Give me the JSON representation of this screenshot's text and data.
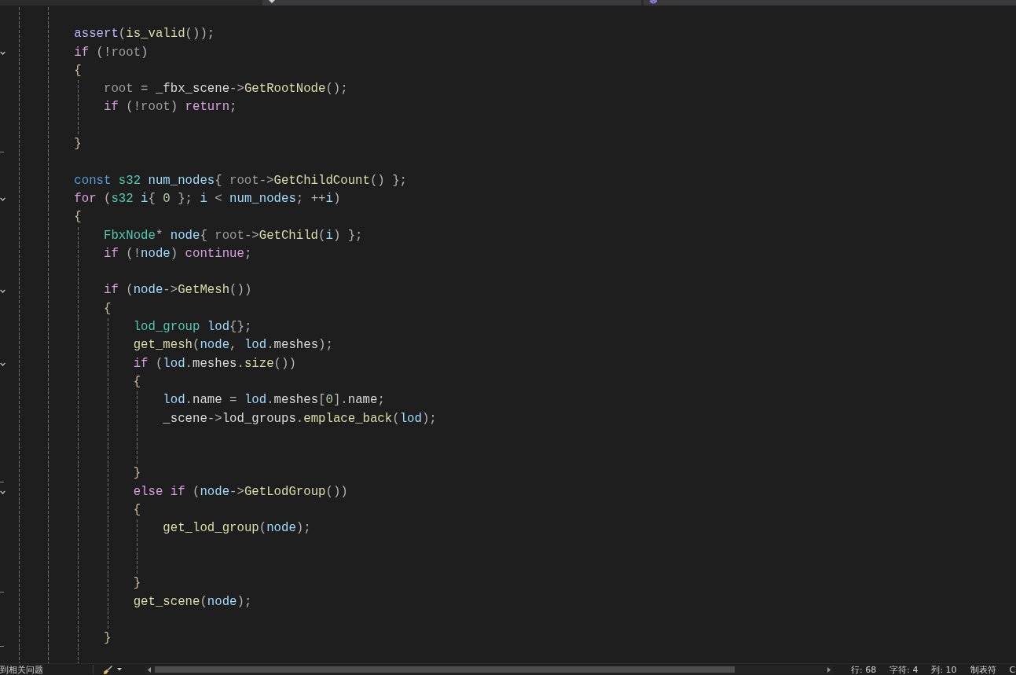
{
  "editor": {
    "items": [
      {
        "kind": "block",
        "children": [
          {
            "kind": "block",
            "children": [
              {
                "kind": "blank"
              },
              {
                "kind": "line",
                "tokens": [
                  {
                    "kind": "macro",
                    "text": "assert"
                  },
                  {
                    "kind": "punct",
                    "text": "("
                  },
                  {
                    "kind": "function",
                    "text": "is_valid"
                  },
                  {
                    "kind": "punct",
                    "text": "());"
                  }
                ]
              },
              {
                "kind": "block",
                "expanded": true,
                "header": [
                  {
                    "kind": "control",
                    "text": "if"
                  },
                  {
                    "kind": "punct",
                    "text": " (!"
                  },
                  {
                    "kind": "muted",
                    "text": "root"
                  },
                  {
                    "kind": "punct",
                    "text": ")"
                  }
                ],
                "open": "{",
                "close": "}",
                "children": [
                  {
                    "kind": "line",
                    "tokens": [
                      {
                        "kind": "muted",
                        "text": "root"
                      },
                      {
                        "kind": "punct",
                        "text": " = "
                      },
                      {
                        "kind": "member",
                        "text": "_fbx_scene"
                      },
                      {
                        "kind": "punct",
                        "text": "->"
                      },
                      {
                        "kind": "function",
                        "text": "GetRootNode"
                      },
                      {
                        "kind": "punct",
                        "text": "();"
                      }
                    ]
                  },
                  {
                    "kind": "line",
                    "tokens": [
                      {
                        "kind": "control",
                        "text": "if"
                      },
                      {
                        "kind": "punct",
                        "text": " (!"
                      },
                      {
                        "kind": "muted",
                        "text": "root"
                      },
                      {
                        "kind": "punct",
                        "text": ") "
                      },
                      {
                        "kind": "control",
                        "text": "return"
                      },
                      {
                        "kind": "punct",
                        "text": ";"
                      }
                    ]
                  },
                  {
                    "kind": "blank"
                  }
                ]
              },
              {
                "kind": "blank"
              },
              {
                "kind": "line",
                "tokens": [
                  {
                    "kind": "keyword",
                    "text": "const"
                  },
                  {
                    "kind": "type",
                    "text": " s32"
                  },
                  {
                    "kind": "local",
                    "text": " num_nodes"
                  },
                  {
                    "kind": "punct",
                    "text": "{ "
                  },
                  {
                    "kind": "muted",
                    "text": "root"
                  },
                  {
                    "kind": "punct",
                    "text": "->"
                  },
                  {
                    "kind": "function",
                    "text": "GetChildCount"
                  },
                  {
                    "kind": "punct",
                    "text": "() };"
                  }
                ]
              },
              {
                "kind": "block",
                "expanded": true,
                "header": [
                  {
                    "kind": "control",
                    "text": "for"
                  },
                  {
                    "kind": "punct",
                    "text": " ("
                  },
                  {
                    "kind": "type",
                    "text": "s32"
                  },
                  {
                    "kind": "local",
                    "text": " i"
                  },
                  {
                    "kind": "punct",
                    "text": "{ "
                  },
                  {
                    "kind": "number",
                    "text": "0"
                  },
                  {
                    "kind": "punct",
                    "text": " }; "
                  },
                  {
                    "kind": "local",
                    "text": "i"
                  },
                  {
                    "kind": "punct",
                    "text": " < "
                  },
                  {
                    "kind": "local",
                    "text": "num_nodes"
                  },
                  {
                    "kind": "punct",
                    "text": "; ++"
                  },
                  {
                    "kind": "local",
                    "text": "i"
                  },
                  {
                    "kind": "punct",
                    "text": ")"
                  }
                ],
                "open": "{",
                "children": [
                  {
                    "kind": "line",
                    "tokens": [
                      {
                        "kind": "type",
                        "text": "FbxNode"
                      },
                      {
                        "kind": "punct",
                        "text": "* "
                      },
                      {
                        "kind": "local",
                        "text": "node"
                      },
                      {
                        "kind": "punct",
                        "text": "{ "
                      },
                      {
                        "kind": "muted",
                        "text": "root"
                      },
                      {
                        "kind": "punct",
                        "text": "->"
                      },
                      {
                        "kind": "function",
                        "text": "GetChild"
                      },
                      {
                        "kind": "punct",
                        "text": "("
                      },
                      {
                        "kind": "local",
                        "text": "i"
                      },
                      {
                        "kind": "punct",
                        "text": ") };"
                      }
                    ]
                  },
                  {
                    "kind": "line",
                    "tokens": [
                      {
                        "kind": "control",
                        "text": "if"
                      },
                      {
                        "kind": "punct",
                        "text": " (!"
                      },
                      {
                        "kind": "local",
                        "text": "node"
                      },
                      {
                        "kind": "punct",
                        "text": ") "
                      },
                      {
                        "kind": "control",
                        "text": "continue"
                      },
                      {
                        "kind": "punct",
                        "text": ";"
                      }
                    ]
                  },
                  {
                    "kind": "blank"
                  },
                  {
                    "kind": "block",
                    "expanded": true,
                    "header": [
                      {
                        "kind": "control",
                        "text": "if"
                      },
                      {
                        "kind": "punct",
                        "text": " ("
                      },
                      {
                        "kind": "local",
                        "text": "node"
                      },
                      {
                        "kind": "punct",
                        "text": "->"
                      },
                      {
                        "kind": "function",
                        "text": "GetMesh"
                      },
                      {
                        "kind": "punct",
                        "text": "())"
                      }
                    ],
                    "open": "{",
                    "close": "}",
                    "children": [
                      {
                        "kind": "line",
                        "tokens": [
                          {
                            "kind": "type",
                            "text": "lod_group"
                          },
                          {
                            "kind": "local",
                            "text": " lod"
                          },
                          {
                            "kind": "punct",
                            "text": "{};"
                          }
                        ]
                      },
                      {
                        "kind": "line",
                        "tokens": [
                          {
                            "kind": "function",
                            "text": "get_mesh"
                          },
                          {
                            "kind": "punct",
                            "text": "("
                          },
                          {
                            "kind": "local",
                            "text": "node"
                          },
                          {
                            "kind": "punct",
                            "text": ", "
                          },
                          {
                            "kind": "local",
                            "text": "lod"
                          },
                          {
                            "kind": "punct",
                            "text": "."
                          },
                          {
                            "kind": "member",
                            "text": "meshes"
                          },
                          {
                            "kind": "punct",
                            "text": ");"
                          }
                        ]
                      },
                      {
                        "kind": "block",
                        "expanded": true,
                        "header": [
                          {
                            "kind": "control",
                            "text": "if"
                          },
                          {
                            "kind": "punct",
                            "text": " ("
                          },
                          {
                            "kind": "local",
                            "text": "lod"
                          },
                          {
                            "kind": "punct",
                            "text": "."
                          },
                          {
                            "kind": "member",
                            "text": "meshes"
                          },
                          {
                            "kind": "punct",
                            "text": "."
                          },
                          {
                            "kind": "function",
                            "text": "size"
                          },
                          {
                            "kind": "punct",
                            "text": "())"
                          }
                        ],
                        "open": "{",
                        "close": "}",
                        "children": [
                          {
                            "kind": "line",
                            "tokens": [
                              {
                                "kind": "local",
                                "text": "lod"
                              },
                              {
                                "kind": "punct",
                                "text": "."
                              },
                              {
                                "kind": "member",
                                "text": "name"
                              },
                              {
                                "kind": "punct",
                                "text": " = "
                              },
                              {
                                "kind": "local",
                                "text": "lod"
                              },
                              {
                                "kind": "punct",
                                "text": "."
                              },
                              {
                                "kind": "member",
                                "text": "meshes"
                              },
                              {
                                "kind": "punct",
                                "text": "["
                              },
                              {
                                "kind": "number",
                                "text": "0"
                              },
                              {
                                "kind": "punct",
                                "text": "]."
                              },
                              {
                                "kind": "member",
                                "text": "name"
                              },
                              {
                                "kind": "punct",
                                "text": ";"
                              }
                            ]
                          },
                          {
                            "kind": "line",
                            "tokens": [
                              {
                                "kind": "member",
                                "text": "_scene"
                              },
                              {
                                "kind": "punct",
                                "text": "->"
                              },
                              {
                                "kind": "member",
                                "text": "lod_groups"
                              },
                              {
                                "kind": "punct",
                                "text": "."
                              },
                              {
                                "kind": "function",
                                "text": "emplace_back"
                              },
                              {
                                "kind": "punct",
                                "text": "("
                              },
                              {
                                "kind": "local",
                                "text": "lod"
                              },
                              {
                                "kind": "punct",
                                "text": ");"
                              }
                            ]
                          },
                          {
                            "kind": "blank"
                          },
                          {
                            "kind": "blank"
                          }
                        ]
                      },
                      {
                        "kind": "block",
                        "expanded": true,
                        "header": [
                          {
                            "kind": "control",
                            "text": "else"
                          },
                          {
                            "kind": "control",
                            "text": " if"
                          },
                          {
                            "kind": "punct",
                            "text": " ("
                          },
                          {
                            "kind": "local",
                            "text": "node"
                          },
                          {
                            "kind": "punct",
                            "text": "->"
                          },
                          {
                            "kind": "function",
                            "text": "GetLodGroup"
                          },
                          {
                            "kind": "punct",
                            "text": "())"
                          }
                        ],
                        "open": "{",
                        "close": "}",
                        "children": [
                          {
                            "kind": "line",
                            "tokens": [
                              {
                                "kind": "function",
                                "text": "get_lod_group"
                              },
                              {
                                "kind": "punct",
                                "text": "("
                              },
                              {
                                "kind": "local",
                                "text": "node"
                              },
                              {
                                "kind": "punct",
                                "text": ");"
                              }
                            ]
                          },
                          {
                            "kind": "blank"
                          },
                          {
                            "kind": "blank"
                          }
                        ]
                      },
                      {
                        "kind": "line",
                        "tokens": [
                          {
                            "kind": "function",
                            "text": "get_scene"
                          },
                          {
                            "kind": "punct",
                            "text": "("
                          },
                          {
                            "kind": "local",
                            "text": "node"
                          },
                          {
                            "kind": "punct",
                            "text": ");"
                          }
                        ]
                      },
                      {
                        "kind": "blank"
                      }
                    ]
                  },
                  {
                    "kind": "blank"
                  }
                ]
              }
            ]
          }
        ]
      }
    ]
  },
  "status_bar": {
    "issues": "到相关问题",
    "items": [
      "行: 68",
      "字符: 4",
      "列: 10",
      "制表符",
      "C"
    ]
  }
}
